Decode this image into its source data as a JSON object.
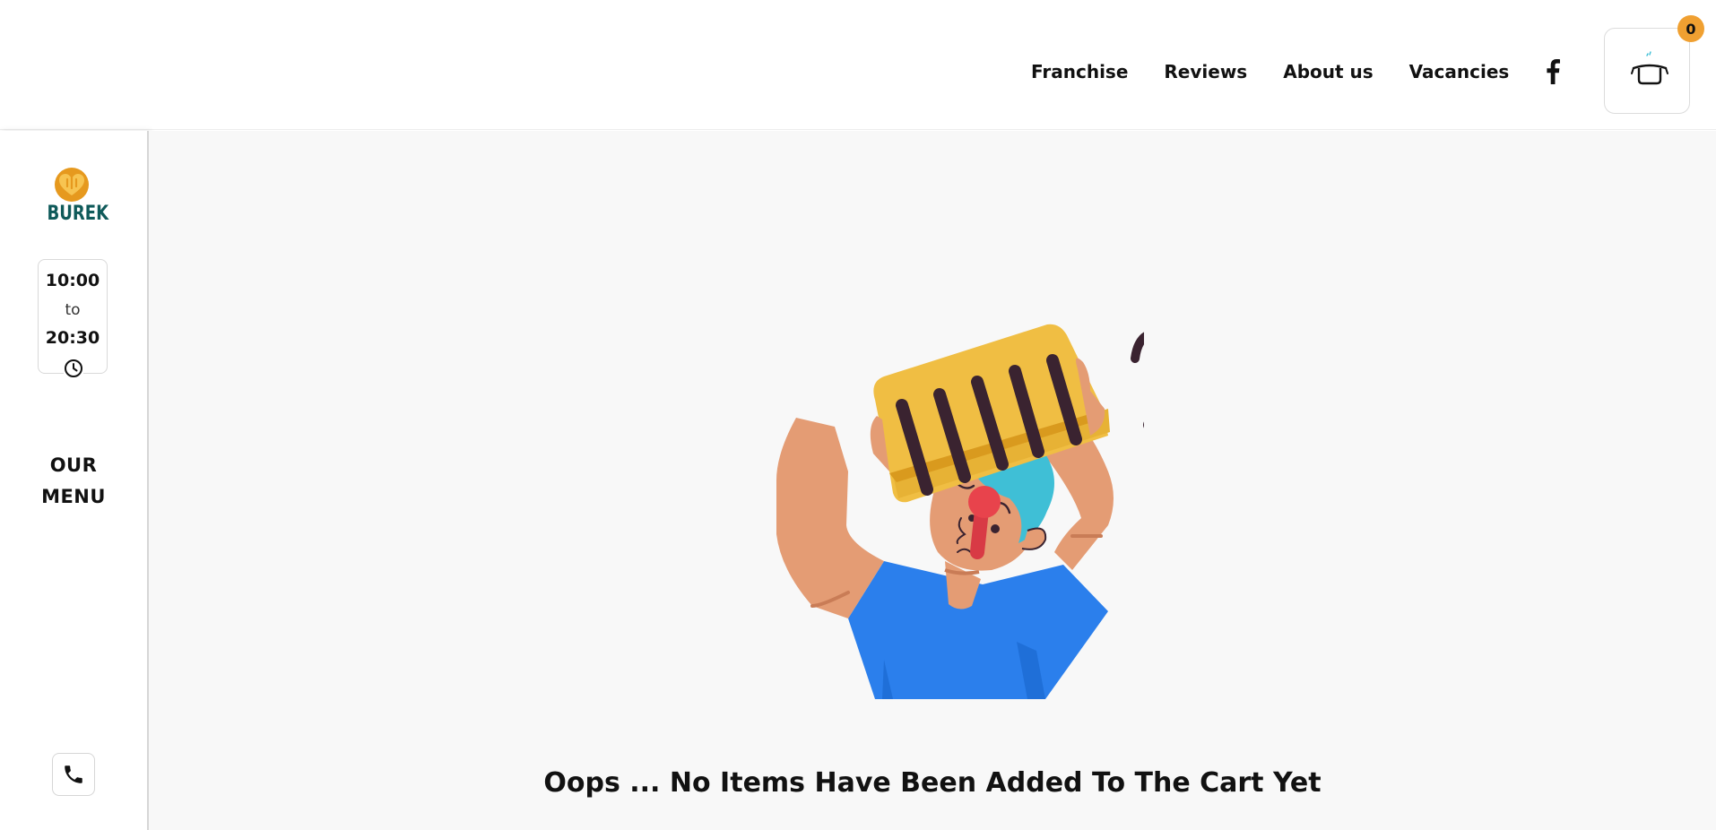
{
  "header": {
    "nav": [
      {
        "label": "Franchise"
      },
      {
        "label": "Reviews"
      },
      {
        "label": "About us"
      },
      {
        "label": "Vacancies"
      }
    ],
    "social_icon": "facebook-icon",
    "cart_icon": "cooking-pot-icon",
    "cart_count": "0"
  },
  "sidebar": {
    "logo_text": "BUREK",
    "hours": {
      "open": "10:00",
      "separator": "to",
      "close": "20:30"
    },
    "menu_label": "OUR MENU",
    "phone_icon": "phone-icon"
  },
  "main": {
    "empty_message": "Oops ... No Items Have Been Added To The Cart Yet"
  },
  "colors": {
    "accent": "#f0a031",
    "logo_teal": "#0f5a5a",
    "background": "#f8f8f8",
    "shirt_blue": "#2b7fec",
    "hair_cyan": "#3fbfd6",
    "basket_yellow": "#f0be43"
  }
}
